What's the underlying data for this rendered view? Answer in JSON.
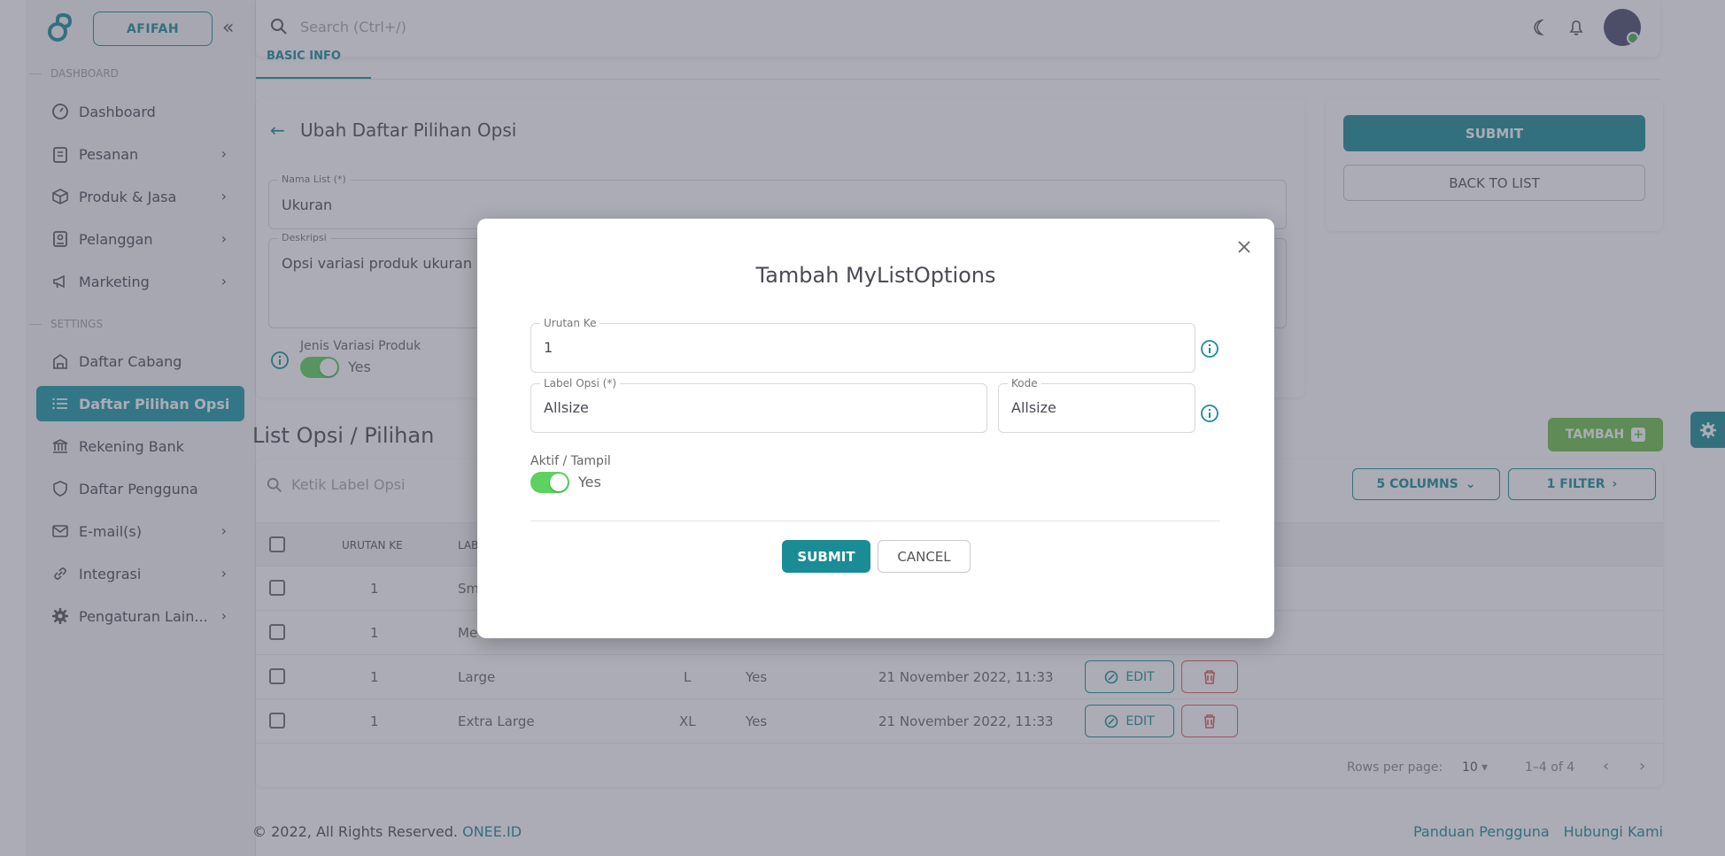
{
  "brand": {
    "user_pill": "AFIFAH"
  },
  "topbar": {
    "search_placeholder": "Search (Ctrl+/)"
  },
  "sidebar": {
    "sections": [
      {
        "label": "DASHBOARD"
      },
      {
        "label": "SETTINGS"
      }
    ],
    "items": [
      {
        "label": "Dashboard",
        "icon": "dashboard-icon",
        "has_chevron": false
      },
      {
        "label": "Pesanan",
        "icon": "clipboard-icon",
        "has_chevron": true
      },
      {
        "label": "Produk & Jasa",
        "icon": "box-icon",
        "has_chevron": true
      },
      {
        "label": "Pelanggan",
        "icon": "id-card-icon",
        "has_chevron": true
      },
      {
        "label": "Marketing",
        "icon": "megaphone-icon",
        "has_chevron": true
      },
      {
        "label": "Daftar Cabang",
        "icon": "building-icon",
        "has_chevron": false
      },
      {
        "label": "Daftar Pilihan Opsi",
        "icon": "list-icon",
        "has_chevron": false,
        "active": true
      },
      {
        "label": "Rekening Bank",
        "icon": "bank-icon",
        "has_chevron": false
      },
      {
        "label": "Daftar Pengguna",
        "icon": "shield-icon",
        "has_chevron": false
      },
      {
        "label": "E-mail(s)",
        "icon": "mail-icon",
        "has_chevron": true
      },
      {
        "label": "Integrasi",
        "icon": "link-icon",
        "has_chevron": true
      },
      {
        "label": "Pengaturan Lain...",
        "icon": "gear-icon",
        "has_chevron": true
      }
    ]
  },
  "tabs": {
    "basic_info": "BASIC INFO"
  },
  "form": {
    "title": "Ubah Daftar Pilihan Opsi",
    "nama_list": {
      "label": "Nama List (*)",
      "value": "Ukuran"
    },
    "deskripsi": {
      "label": "Deskripsi",
      "value": "Opsi variasi produk ukuran"
    },
    "jenis_variasi": {
      "label": "Jenis Variasi Produk",
      "value": "Yes"
    }
  },
  "actions": {
    "submit": "SUBMIT",
    "back": "BACK TO LIST"
  },
  "list": {
    "title": "List Opsi / Pilihan",
    "add_button": "TAMBAH",
    "search_placeholder": "Ketik Label Opsi",
    "columns_button": "5 COLUMNS",
    "filter_button": "1 FILTER",
    "headers": [
      "URUTAN KE",
      "LAB"
    ],
    "rows": [
      {
        "urutan": "1",
        "label": "Sm",
        "kode": "",
        "aktif": "",
        "tanggal": ""
      },
      {
        "urutan": "1",
        "label": "Me",
        "kode": "",
        "aktif": "",
        "tanggal": ""
      },
      {
        "urutan": "1",
        "label": "Large",
        "kode": "L",
        "aktif": "Yes",
        "tanggal": "21 November 2022, 11:33"
      },
      {
        "urutan": "1",
        "label": "Extra Large",
        "kode": "XL",
        "aktif": "Yes",
        "tanggal": "21 November 2022, 11:33"
      }
    ],
    "edit_label": "EDIT",
    "rows_per_page_label": "Rows per page:",
    "rows_per_page_value": "10",
    "range": "1–4 of 4"
  },
  "footer": {
    "copyright": "© 2022, All Rights Reserved.",
    "brand": "ONEE.ID",
    "links": [
      "Panduan Pengguna",
      "Hubungi Kami"
    ]
  },
  "modal": {
    "title": "Tambah MyListOptions",
    "urutan": {
      "label": "Urutan Ke",
      "value": "1"
    },
    "label_opsi": {
      "label": "Label Opsi (*)",
      "value": "Allsize"
    },
    "kode": {
      "label": "Kode",
      "value": "Allsize"
    },
    "aktif": {
      "label": "Aktif / Tampil",
      "value": "Yes"
    },
    "submit": "SUBMIT",
    "cancel": "CANCEL"
  },
  "colors": {
    "primary": "#1a8c96",
    "success": "#6ec04a",
    "toggle_on": "#5dd25f",
    "danger": "#e05a5a"
  }
}
